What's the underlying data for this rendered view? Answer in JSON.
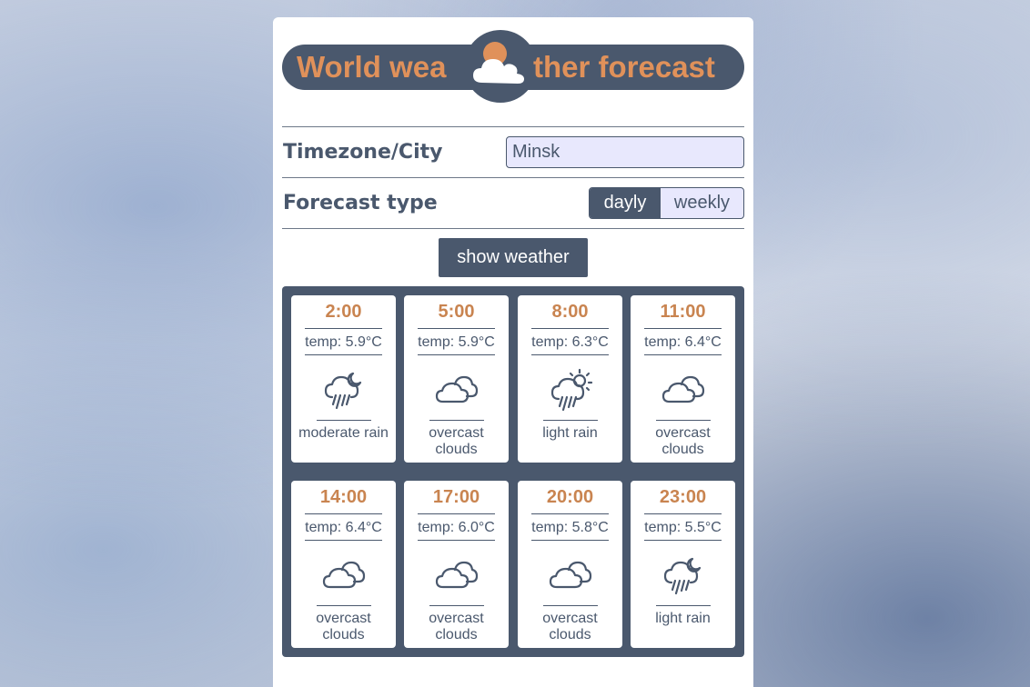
{
  "logo": {
    "text_left": "World wea",
    "text_right": "ther forecast",
    "icon": "sun-behind-cloud-icon"
  },
  "form": {
    "city_label": "Timezone/City",
    "city_value": "Minsk",
    "forecast_label": "Forecast type",
    "option_daily": "dayly",
    "option_weekly": "weekly",
    "selected_option": "dayly",
    "show_button": "show weather"
  },
  "forecast": [
    {
      "time": "2:00",
      "temp": "temp: 5.9°C",
      "icon": "rain-cloud-moon-icon",
      "desc": "moderate rain"
    },
    {
      "time": "5:00",
      "temp": "temp: 5.9°C",
      "icon": "overcast-clouds-icon",
      "desc": "overcast clouds"
    },
    {
      "time": "8:00",
      "temp": "temp: 6.3°C",
      "icon": "rain-cloud-sun-icon",
      "desc": "light rain"
    },
    {
      "time": "11:00",
      "temp": "temp: 6.4°C",
      "icon": "overcast-clouds-icon",
      "desc": "overcast clouds"
    },
    {
      "time": "14:00",
      "temp": "temp: 6.4°C",
      "icon": "overcast-clouds-icon",
      "desc": "overcast clouds"
    },
    {
      "time": "17:00",
      "temp": "temp: 6.0°C",
      "icon": "overcast-clouds-icon",
      "desc": "overcast clouds"
    },
    {
      "time": "20:00",
      "temp": "temp: 5.8°C",
      "icon": "overcast-clouds-icon",
      "desc": "overcast clouds"
    },
    {
      "time": "23:00",
      "temp": "temp: 5.5°C",
      "icon": "rain-cloud-moon-icon",
      "desc": "light rain"
    }
  ],
  "colors": {
    "primary": "#4a586d",
    "accent": "#e0915a",
    "time": "#c98450",
    "input_bg": "#e8e8fd"
  }
}
